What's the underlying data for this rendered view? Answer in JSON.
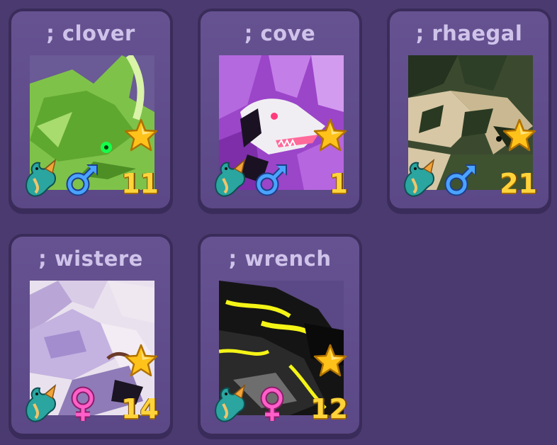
{
  "pets": [
    {
      "name": "; clover",
      "level": "11",
      "gender": "male",
      "portrait": "green-dragon"
    },
    {
      "name": "; cove",
      "level": "1",
      "gender": "male",
      "portrait": "purple-crystal-dragon"
    },
    {
      "name": "; rhaegal",
      "level": "21",
      "gender": "male",
      "portrait": "camo-dragon"
    },
    {
      "name": "; wistere",
      "level": "14",
      "gender": "female",
      "portrait": "lavender-dragon"
    },
    {
      "name": "; wrench",
      "level": "12",
      "gender": "female",
      "portrait": "black-yellow-dragon"
    }
  ],
  "colors": {
    "background": "#4b3a70",
    "card": "#5b4886",
    "name_text": "#cfc3ea",
    "level_text": "#ffd43b",
    "male_icon": "#4aa3ff",
    "female_icon": "#ff5fc8",
    "star": "#ffc21a"
  },
  "icons": {
    "star": "star-icon",
    "species": "dragon-species-icon",
    "male": "male-symbol-icon",
    "female": "female-symbol-icon"
  }
}
